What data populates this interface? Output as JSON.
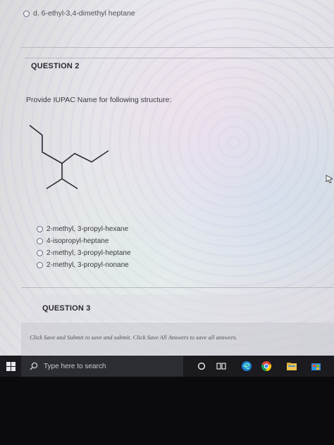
{
  "previous_question": {
    "option_d": "d. 6-ethyl-3,4-dimethyl heptane"
  },
  "question2": {
    "header": "QUESTION 2",
    "prompt": "Provide IUPAC Name for following structure:",
    "options": [
      "2-methyl, 3-propyl-hexane",
      "4-isopropyl-heptane",
      "2-methyl, 3-propyl-heptane",
      "2-methyl, 3-propyl-nonane"
    ]
  },
  "question3": {
    "header": "QUESTION 3"
  },
  "footer": {
    "instructions": "Click Save and Submit to save and submit. Click Save All Answers to save all answers."
  },
  "taskbar": {
    "search_placeholder": "Type here to search"
  },
  "icons": {
    "start": "windows-logo-icon",
    "search": "search-icon",
    "cortana": "cortana-circle-icon",
    "task_view": "task-view-icon",
    "edge": "edge-browser-icon",
    "chrome": "chrome-browser-icon",
    "file_explorer": "file-explorer-icon",
    "store": "store-icon"
  },
  "colors": {
    "taskbar_bg": "#1a1a1f",
    "search_bg": "#2c2c33",
    "radio_border": "#6a6f8a"
  }
}
